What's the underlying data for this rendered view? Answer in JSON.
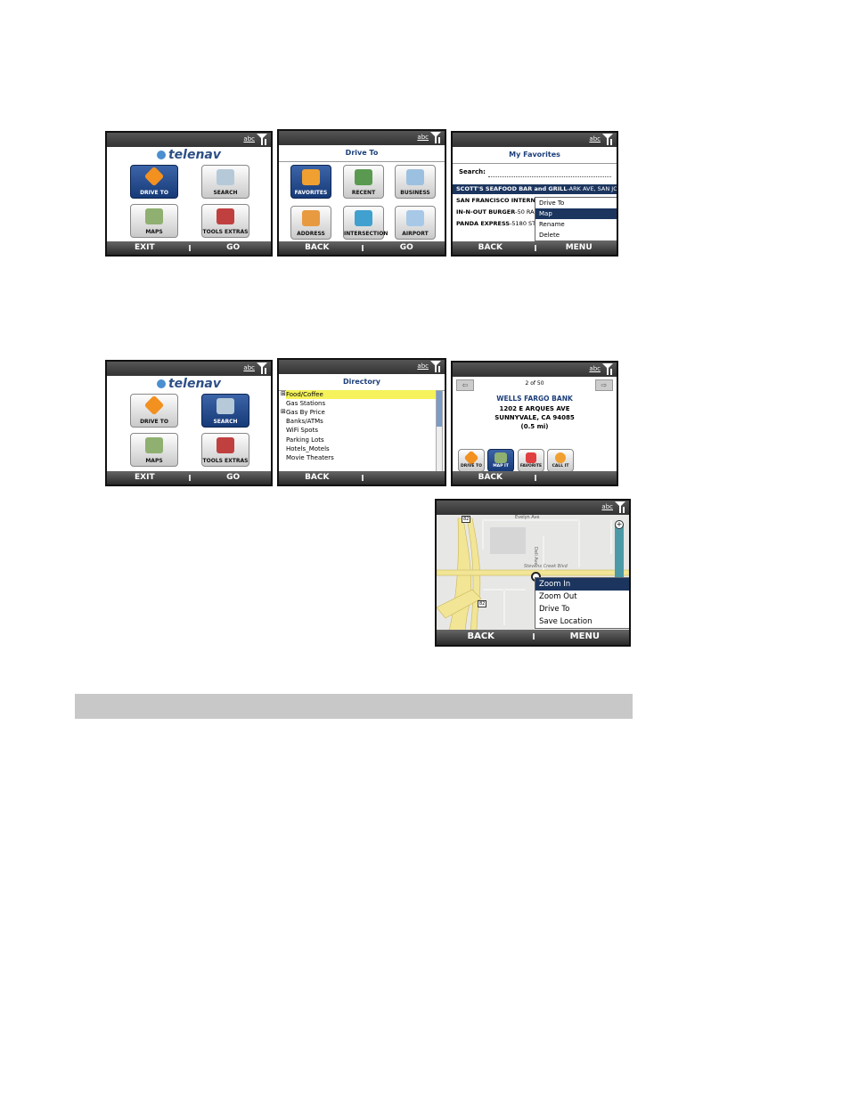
{
  "common": {
    "status_abc": "abc"
  },
  "s1": {
    "logo": "telenav",
    "tiles": [
      "DRIVE TO",
      "SEARCH",
      "MAPS",
      "TOOLS EXTRAS"
    ],
    "left": "EXIT",
    "right": "GO"
  },
  "s2": {
    "title": "Drive To",
    "tiles": [
      "FAVORITES",
      "RECENT",
      "BUSINESS",
      "ADDRESS",
      "INTERSECTION",
      "AIRPORT"
    ],
    "left": "BACK",
    "right": "GO"
  },
  "s3": {
    "title": "My Favorites",
    "search_label": "Search:",
    "rows": [
      {
        "bold": "SCOTT'S SEAFOOD BAR  and  GRILL",
        "rest": "-ARK AVE, SAN JO"
      },
      {
        "bold": "SAN FRANCISCO INTERNAT",
        "rest": ""
      },
      {
        "bold": "IN-N-OUT BURGER",
        "rest": "-50 RAN"
      },
      {
        "bold": "PANDA EXPRESS",
        "rest": "-5180 STEV"
      }
    ],
    "menu": [
      "Drive To",
      "Map",
      "Rename",
      "Delete"
    ],
    "left": "BACK",
    "right": "MENU"
  },
  "s4": {
    "logo": "telenav",
    "tiles": [
      "DRIVE TO",
      "SEARCH",
      "MAPS",
      "TOOLS EXTRAS"
    ],
    "left": "EXIT",
    "right": "GO"
  },
  "s5": {
    "title": "Directory",
    "items": [
      "Food/Coffee",
      "Gas Stations",
      "Gas By Price",
      "Banks/ATMs",
      "WiFi Spots",
      "Parking Lots",
      "Hotels_Motels",
      "Movie Theaters"
    ],
    "left": "BACK"
  },
  "s6": {
    "pager": "2 of 50",
    "name": "WELLS FARGO BANK",
    "addr1": "1202 E ARQUES AVE",
    "addr2": "SUNNYVALE, CA 94085",
    "dist": "(0.5 mi)",
    "buttons": [
      "DRIVE TO",
      "MAP IT",
      "FAVORITE",
      "CALL IT"
    ],
    "left": "BACK"
  },
  "s7": {
    "street1": "Evelyn Ave",
    "street2": "Stevens Creek Blvd",
    "street3": "Dell Ave",
    "shield1": "82",
    "shield2": "82",
    "menu": [
      "Zoom In",
      "Zoom Out",
      "Drive To",
      "Save Location"
    ],
    "left": "BACK",
    "right": "MENU"
  },
  "colors": {
    "highlight": "#1b355f",
    "yellow": "#f5e25b",
    "road": "#f2e596"
  }
}
